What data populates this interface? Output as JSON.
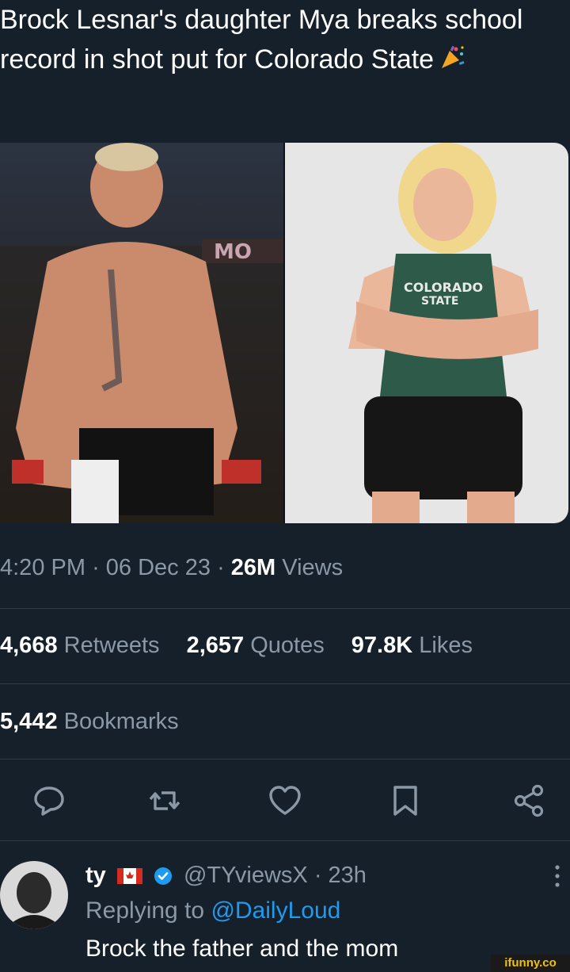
{
  "tweet": {
    "text": "Brock Lesnar's daughter Mya breaks school record in shot put for Colorado State",
    "emoji": "party-popper-icon"
  },
  "media": {
    "left_photo_text": "MO",
    "right_jersey_text_1": "COLORADO",
    "right_jersey_text_2": "STATE"
  },
  "meta": {
    "time": "4:20 PM",
    "date": "06 Dec 23",
    "views_count": "26M",
    "views_label": "Views",
    "separator": "·"
  },
  "stats": {
    "retweets_count": "4,668",
    "retweets_label": "Retweets",
    "quotes_count": "2,657",
    "quotes_label": "Quotes",
    "likes_count": "97.8K",
    "likes_label": "Likes",
    "bookmarks_count": "5,442",
    "bookmarks_label": "Bookmarks"
  },
  "actions": [
    "reply-icon",
    "retweet-icon",
    "like-icon",
    "bookmark-icon",
    "share-icon"
  ],
  "reply": {
    "name": "ty",
    "handle": "@TYviewsX",
    "time": "23h",
    "separator": "·",
    "replying_prefix": "Replying to",
    "replying_handle": "@DailyLoud",
    "text": "Brock the father and the mom"
  },
  "watermark": "ifunny.co",
  "colors": {
    "background": "#15202b",
    "muted": "#8b98a5",
    "link": "#1d9bf0",
    "divider": "#2f3b47"
  }
}
